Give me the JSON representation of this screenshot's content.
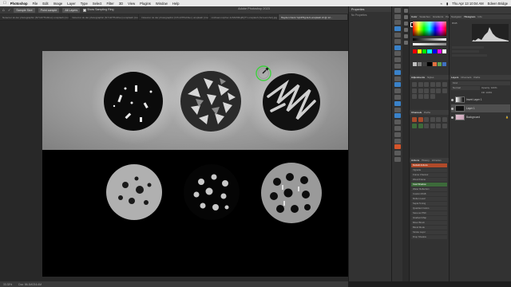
{
  "menubar": {
    "app_name": "Photoshop",
    "items": [
      "File",
      "Edit",
      "Image",
      "Layer",
      "Type",
      "Select",
      "Filter",
      "3D",
      "View",
      "Plugins",
      "Window",
      "Help"
    ],
    "clock": "Thu Apr 13  10:04 AM",
    "user": "Edeen Bridge"
  },
  "window": {
    "title": "Adobe Photoshop 2023"
  },
  "options": {
    "sample_size": "Sample Size",
    "sample": "Point sample",
    "sample_mode": "All Layers",
    "show_ring": "Show Sampling Ring"
  },
  "tabs": [
    {
      "label": "Notecrer sk der photographic (N7m07Hubhuc) unsplash (mvmmmmll.jpg @ 100..."
    },
    {
      "label": "Notecrer sk der photographic (N7m07Hubhuc) unsplash (mvmmmmll.jpg @ 100..."
    },
    {
      "label": "Notecrer sk der photographic (N7m07Hubhuc) unsplash (mvmmmmll.jpg @ 100..."
    },
    {
      "label": "michael-mcpher-1nMG5DLj8Q7Y-unsplash (Screenshot).jpg @ 100% (Layer 1..."
    },
    {
      "label": "Hayden Nerd-YqCPHgmL6-unsplash.tif @ 12..."
    }
  ],
  "status": {
    "zoom": "33.33%",
    "doc": "Doc: 86.1M/216.4M"
  },
  "properties": {
    "title": "Properties",
    "subtitle": "No Properties"
  },
  "panels": {
    "color_tabs": [
      "Color",
      "Swatches",
      "Gradients",
      "Patterns"
    ],
    "histogram_tabs": [
      "Navigator",
      "Histogram",
      "Info"
    ],
    "histogram_channel": "RGB",
    "adjust_tabs": [
      "Adjustments",
      "Styles"
    ],
    "channels_tabs": [
      "Channels",
      "Paths"
    ],
    "layers_tabs": [
      "Layers",
      "Channels",
      "Paths"
    ],
    "layers_kind": "Kind",
    "layers_mode": "Normal",
    "layers_opacity": "Opacity: 100%",
    "layers_fill": "Fill: 100%",
    "actions_tabs": [
      "Actions",
      "History",
      "Libraries"
    ]
  },
  "layers": [
    {
      "name": "Invert Layer 1"
    },
    {
      "name": "Layer 1"
    },
    {
      "name": "Background"
    }
  ],
  "actions": [
    "Default Actions",
    "Vignette",
    "Frame Channel",
    "Wood Frame",
    "Cast Shadow",
    "Water Reflection",
    "Custom RGB",
    "Molten Lead",
    "Sepia Toning",
    "Quadrant Colors",
    "Save as PSD",
    "Gradient Map",
    "Mixer Brush",
    "Blend Mode",
    "Stroke Layer",
    "Drop Shadow"
  ],
  "colors": {
    "accent": "#3a82c9",
    "highlight": "#b04a2a",
    "eyedropper_ring": "#3ed13e"
  }
}
